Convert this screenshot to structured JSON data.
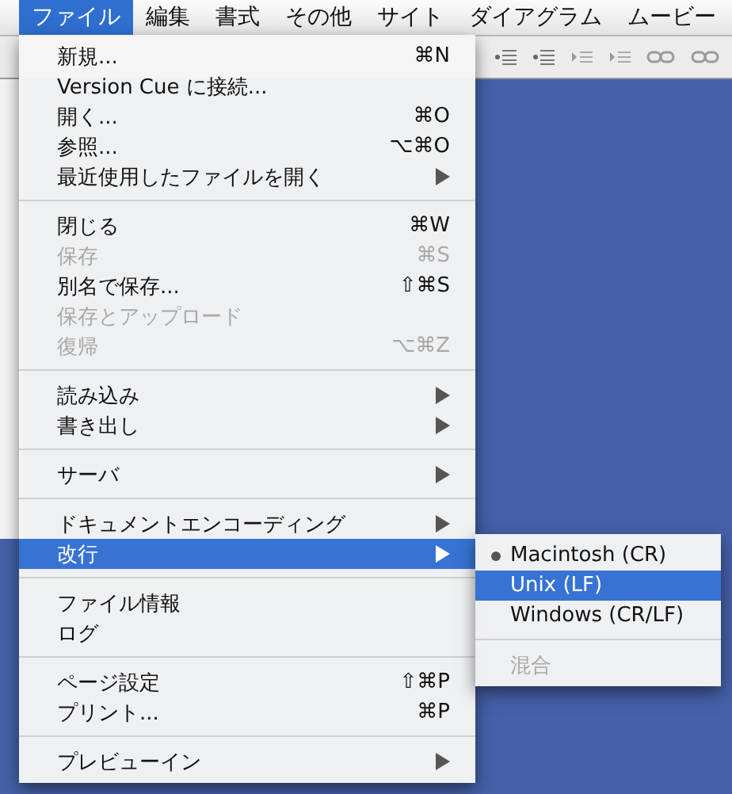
{
  "menubar": {
    "items": [
      {
        "label": "ファイル",
        "selected": true
      },
      {
        "label": "編集",
        "selected": false
      },
      {
        "label": "書式",
        "selected": false
      },
      {
        "label": "その他",
        "selected": false
      },
      {
        "label": "サイト",
        "selected": false
      },
      {
        "label": "ダイアグラム",
        "selected": false
      },
      {
        "label": "ムービー",
        "selected": false
      }
    ]
  },
  "file_menu": {
    "sections": [
      [
        {
          "label": "新規...",
          "shortcut": "⌘N",
          "disabled": false,
          "submenu": false,
          "selected": false
        },
        {
          "label": "Version Cue に接続...",
          "disabled": false,
          "submenu": false,
          "selected": false
        },
        {
          "label": "開く...",
          "shortcut": "⌘O",
          "disabled": false,
          "submenu": false,
          "selected": false
        },
        {
          "label": "参照...",
          "shortcut": "⌥⌘O",
          "disabled": false,
          "submenu": false,
          "selected": false
        },
        {
          "label": "最近使用したファイルを開く",
          "disabled": false,
          "submenu": true,
          "selected": false
        }
      ],
      [
        {
          "label": "閉じる",
          "shortcut": "⌘W",
          "disabled": false,
          "submenu": false,
          "selected": false
        },
        {
          "label": "保存",
          "shortcut": "⌘S",
          "disabled": true,
          "submenu": false,
          "selected": false
        },
        {
          "label": "別名で保存...",
          "shortcut": "⇧⌘S",
          "disabled": false,
          "submenu": false,
          "selected": false
        },
        {
          "label": "保存とアップロード",
          "disabled": true,
          "submenu": false,
          "selected": false
        },
        {
          "label": "復帰",
          "shortcut": "⌥⌘Z",
          "disabled": true,
          "submenu": false,
          "selected": false
        }
      ],
      [
        {
          "label": "読み込み",
          "disabled": false,
          "submenu": true,
          "selected": false
        },
        {
          "label": "書き出し",
          "disabled": false,
          "submenu": true,
          "selected": false
        }
      ],
      [
        {
          "label": "サーバ",
          "disabled": false,
          "submenu": true,
          "selected": false
        }
      ],
      [
        {
          "label": "ドキュメントエンコーディング",
          "disabled": false,
          "submenu": true,
          "selected": false
        },
        {
          "label": "改行",
          "disabled": false,
          "submenu": true,
          "selected": true
        }
      ],
      [
        {
          "label": "ファイル情報",
          "disabled": false,
          "submenu": false,
          "selected": false
        },
        {
          "label": "ログ",
          "disabled": false,
          "submenu": false,
          "selected": false
        }
      ],
      [
        {
          "label": "ページ設定",
          "shortcut": "⇧⌘P",
          "disabled": false,
          "submenu": false,
          "selected": false
        },
        {
          "label": "プリント...",
          "shortcut": "⌘P",
          "disabled": false,
          "submenu": false,
          "selected": false
        }
      ],
      [
        {
          "label": "プレビューイン",
          "disabled": false,
          "submenu": true,
          "selected": false
        }
      ]
    ]
  },
  "line_break_submenu": {
    "sections": [
      [
        {
          "label": "Macintosh (CR)",
          "checked": true,
          "selected": false,
          "disabled": false
        },
        {
          "label": "Unix (LF)",
          "checked": false,
          "selected": true,
          "disabled": false
        },
        {
          "label": "Windows (CR/LF)",
          "checked": false,
          "selected": false,
          "disabled": false
        }
      ],
      [
        {
          "label": "混合",
          "checked": false,
          "selected": false,
          "disabled": true
        }
      ]
    ]
  }
}
